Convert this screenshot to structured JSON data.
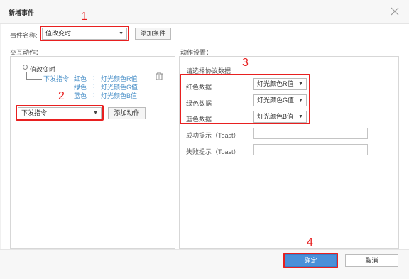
{
  "dialog": {
    "title": "新增事件",
    "close_icon": "close-icon"
  },
  "event": {
    "label": "事件名称:",
    "value": "值改变时",
    "add_condition": "添加条件"
  },
  "left": {
    "section_label": "交互动作：",
    "tree_root": "值改变时",
    "command": "下发指令",
    "rows": [
      {
        "color": "红色",
        "sep": ":",
        "value": "灯光颜色R值"
      },
      {
        "color": "绿色",
        "sep": ":",
        "value": "灯光颜色G值"
      },
      {
        "color": "蓝色",
        "sep": ":",
        "value": "灯光颜色B值"
      }
    ],
    "action_select": "下发指令",
    "add_action": "添加动作"
  },
  "right": {
    "section_label": "动作设置：",
    "protocol_placeholder": "请选择协议数据",
    "fields": [
      {
        "label": "红色数据",
        "value": "灯光颜色R值"
      },
      {
        "label": "绿色数据",
        "value": "灯光颜色G值"
      },
      {
        "label": "蓝色数据",
        "value": "灯光颜色B值"
      }
    ],
    "success_label": "成功提示（Toast）",
    "fail_label": "失败提示（Toast）"
  },
  "footer": {
    "ok": "确定",
    "cancel": "取消"
  },
  "annotations": [
    "1",
    "2",
    "3",
    "4"
  ],
  "colors": {
    "annotation": "#e82020",
    "link_blue": "#4a90c8",
    "primary": "#4a90d9"
  }
}
